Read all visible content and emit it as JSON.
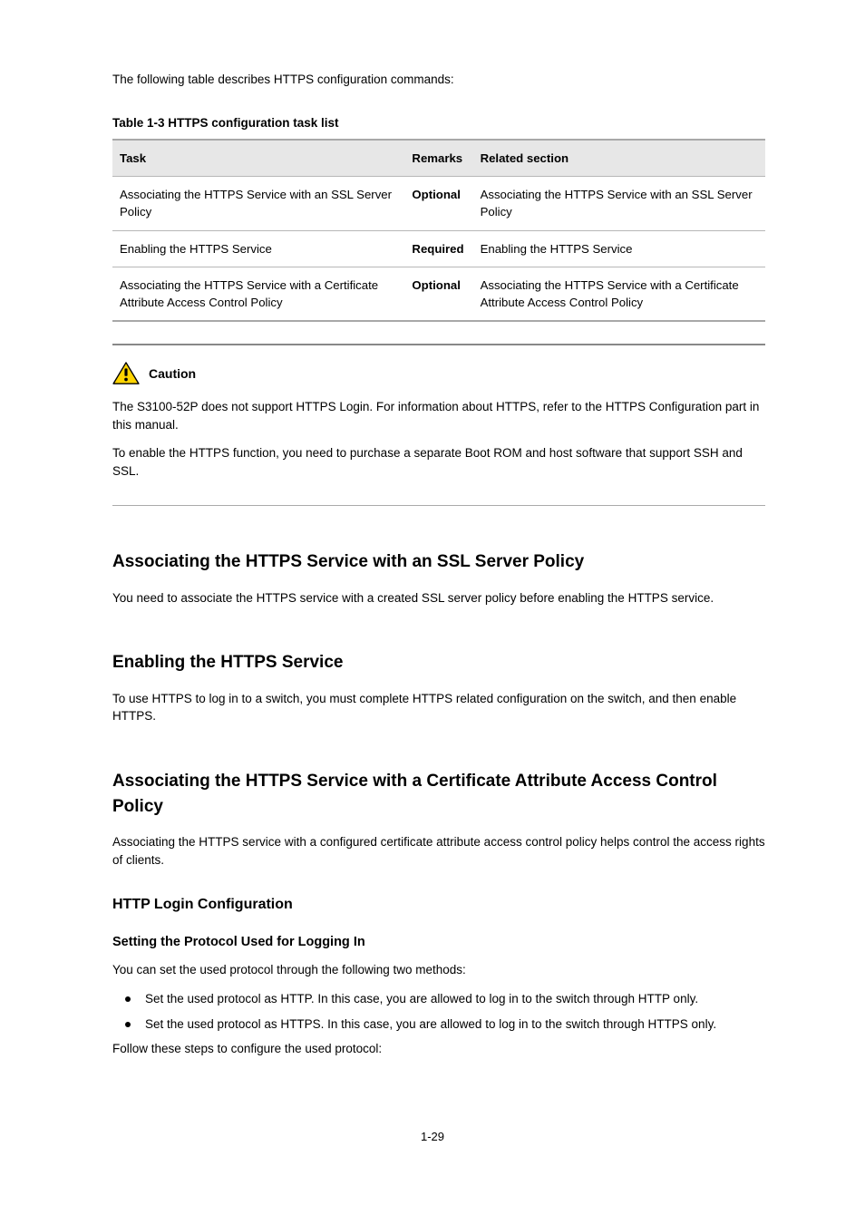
{
  "intro": "The following table describes HTTPS configuration commands:",
  "table_caption": "Table 1-3 HTTPS configuration task list",
  "table": {
    "headers": [
      "Task",
      "Remarks",
      "Related section"
    ],
    "rows": [
      {
        "task": "Associating the HTTPS Service with an SSL Server Policy",
        "remarks": "Optional",
        "section": "Associating the HTTPS Service with an SSL Server Policy"
      },
      {
        "task": "Enabling the HTTPS Service",
        "remarks": "Required",
        "section": "Enabling the HTTPS Service"
      },
      {
        "task": "Associating the HTTPS Service with a Certificate Attribute Access Control Policy",
        "remarks": "Optional",
        "section": "Associating the HTTPS Service with a Certificate Attribute Access Control Policy"
      }
    ]
  },
  "caution": {
    "label": "Caution",
    "p1": "The S3100-52P does not support HTTPS Login. For information about HTTPS, refer to the HTTPS Configuration part in this manual.",
    "p2": "To enable the HTTPS function, you need to purchase a separate Boot ROM and host software that support SSH and SSL."
  },
  "sect_ssl": {
    "h2": "Associating the HTTPS Service with an SSL Server Policy",
    "p": "You need to associate the HTTPS service with a created SSL server policy before enabling the HTTPS service."
  },
  "sect_enable": {
    "h2": "Enabling the HTTPS Service",
    "p": "To use HTTPS to log in to a switch, you must complete HTTPS related configuration on the switch, and then enable HTTPS."
  },
  "sect_cert": {
    "h2": "Associating the HTTPS Service with a Certificate Attribute Access Control Policy",
    "p": "Associating the HTTPS service with a configured certificate attribute access control policy helps control the access rights of clients."
  },
  "sect_login_cfg": {
    "h3": "HTTP Login Configuration",
    "h4": "Setting the Protocol Used for Logging In",
    "lead": "You can set the used protocol through the following two methods:",
    "bullets": [
      "Set the used protocol as HTTP. In this case, you are allowed to log in to the switch through HTTP only.",
      "Set the used protocol as HTTPS. In this case, you are allowed to log in to the switch through HTTPS only."
    ],
    "tail": "Follow these steps to configure the used protocol:"
  },
  "page_number": "1-29"
}
